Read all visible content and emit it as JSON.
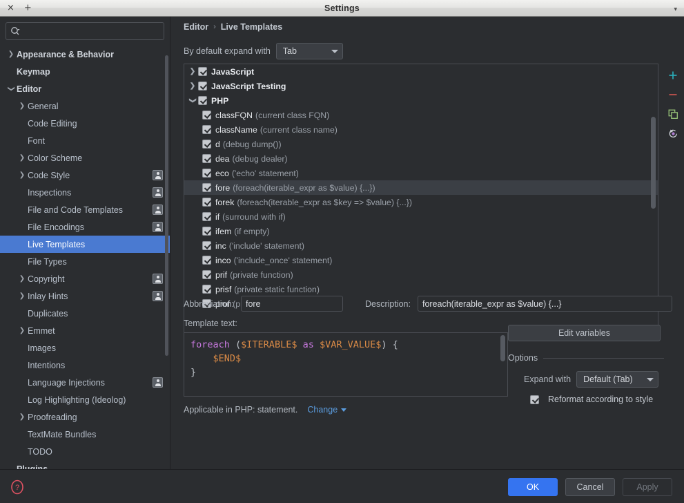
{
  "window": {
    "title": "Settings",
    "close_label": "×",
    "add_label": "+",
    "menu_caret": "▾"
  },
  "sidebar": {
    "search": {
      "value": "",
      "placeholder": ""
    },
    "items": [
      {
        "label": "Appearance & Behavior",
        "level": 0,
        "arrow": "collapsed",
        "bold": true,
        "badge": false,
        "selected": false
      },
      {
        "label": "Keymap",
        "level": 0,
        "arrow": "none",
        "bold": true,
        "badge": false,
        "selected": false
      },
      {
        "label": "Editor",
        "level": 0,
        "arrow": "expanded",
        "bold": true,
        "badge": false,
        "selected": false
      },
      {
        "label": "General",
        "level": 1,
        "arrow": "collapsed",
        "bold": false,
        "badge": false,
        "selected": false
      },
      {
        "label": "Code Editing",
        "level": 1,
        "arrow": "none",
        "bold": false,
        "badge": false,
        "selected": false
      },
      {
        "label": "Font",
        "level": 1,
        "arrow": "none",
        "bold": false,
        "badge": false,
        "selected": false
      },
      {
        "label": "Color Scheme",
        "level": 1,
        "arrow": "collapsed",
        "bold": false,
        "badge": false,
        "selected": false
      },
      {
        "label": "Code Style",
        "level": 1,
        "arrow": "collapsed",
        "bold": false,
        "badge": true,
        "selected": false
      },
      {
        "label": "Inspections",
        "level": 1,
        "arrow": "none",
        "bold": false,
        "badge": true,
        "selected": false
      },
      {
        "label": "File and Code Templates",
        "level": 1,
        "arrow": "none",
        "bold": false,
        "badge": true,
        "selected": false
      },
      {
        "label": "File Encodings",
        "level": 1,
        "arrow": "none",
        "bold": false,
        "badge": true,
        "selected": false
      },
      {
        "label": "Live Templates",
        "level": 1,
        "arrow": "none",
        "bold": false,
        "badge": false,
        "selected": true
      },
      {
        "label": "File Types",
        "level": 1,
        "arrow": "none",
        "bold": false,
        "badge": false,
        "selected": false
      },
      {
        "label": "Copyright",
        "level": 1,
        "arrow": "collapsed",
        "bold": false,
        "badge": true,
        "selected": false
      },
      {
        "label": "Inlay Hints",
        "level": 1,
        "arrow": "collapsed",
        "bold": false,
        "badge": true,
        "selected": false
      },
      {
        "label": "Duplicates",
        "level": 1,
        "arrow": "none",
        "bold": false,
        "badge": false,
        "selected": false
      },
      {
        "label": "Emmet",
        "level": 1,
        "arrow": "collapsed",
        "bold": false,
        "badge": false,
        "selected": false
      },
      {
        "label": "Images",
        "level": 1,
        "arrow": "none",
        "bold": false,
        "badge": false,
        "selected": false
      },
      {
        "label": "Intentions",
        "level": 1,
        "arrow": "none",
        "bold": false,
        "badge": false,
        "selected": false
      },
      {
        "label": "Language Injections",
        "level": 1,
        "arrow": "none",
        "bold": false,
        "badge": true,
        "selected": false
      },
      {
        "label": "Log Highlighting (Ideolog)",
        "level": 1,
        "arrow": "none",
        "bold": false,
        "badge": false,
        "selected": false
      },
      {
        "label": "Proofreading",
        "level": 1,
        "arrow": "collapsed",
        "bold": false,
        "badge": false,
        "selected": false
      },
      {
        "label": "TextMate Bundles",
        "level": 1,
        "arrow": "none",
        "bold": false,
        "badge": false,
        "selected": false
      },
      {
        "label": "TODO",
        "level": 1,
        "arrow": "none",
        "bold": false,
        "badge": false,
        "selected": false
      },
      {
        "label": "Plugins",
        "level": 0,
        "arrow": "none",
        "bold": true,
        "badge": false,
        "selected": false
      }
    ]
  },
  "breadcrumb": {
    "parent": "Editor",
    "separator": "›",
    "current": "Live Templates"
  },
  "expand_default": {
    "label": "By default expand with",
    "value": "Tab"
  },
  "templates": [
    {
      "kind": "group",
      "arrow": "collapsed",
      "abbr": "JavaScript",
      "desc": "",
      "checked": true,
      "selected": false
    },
    {
      "kind": "group",
      "arrow": "collapsed",
      "abbr": "JavaScript Testing",
      "desc": "",
      "checked": true,
      "selected": false
    },
    {
      "kind": "group",
      "arrow": "expanded",
      "abbr": "PHP",
      "desc": "",
      "checked": true,
      "selected": false
    },
    {
      "kind": "child",
      "abbr": "classFQN",
      "desc": "(current class FQN)",
      "checked": true,
      "selected": false
    },
    {
      "kind": "child",
      "abbr": "className",
      "desc": "(current class name)",
      "checked": true,
      "selected": false
    },
    {
      "kind": "child",
      "abbr": "d",
      "desc": "(debug dump())",
      "checked": true,
      "selected": false
    },
    {
      "kind": "child",
      "abbr": "dea",
      "desc": "(debug dealer)",
      "checked": true,
      "selected": false
    },
    {
      "kind": "child",
      "abbr": "eco",
      "desc": "('echo' statement)",
      "checked": true,
      "selected": false
    },
    {
      "kind": "child",
      "abbr": "fore",
      "desc": "(foreach(iterable_expr as $value) {...})",
      "checked": true,
      "selected": true
    },
    {
      "kind": "child",
      "abbr": "forek",
      "desc": "(foreach(iterable_expr as $key => $value) {...})",
      "checked": true,
      "selected": false
    },
    {
      "kind": "child",
      "abbr": "if",
      "desc": "(surround with if)",
      "checked": true,
      "selected": false
    },
    {
      "kind": "child",
      "abbr": "ifem",
      "desc": "(if empty)",
      "checked": true,
      "selected": false
    },
    {
      "kind": "child",
      "abbr": "inc",
      "desc": "('include' statement)",
      "checked": true,
      "selected": false
    },
    {
      "kind": "child",
      "abbr": "inco",
      "desc": "('include_once' statement)",
      "checked": true,
      "selected": false
    },
    {
      "kind": "child",
      "abbr": "prif",
      "desc": "(private function)",
      "checked": true,
      "selected": false
    },
    {
      "kind": "child",
      "abbr": "prisf",
      "desc": "(private static function)",
      "checked": true,
      "selected": false
    },
    {
      "kind": "child",
      "abbr": "prof",
      "desc": "(protected function)",
      "checked": true,
      "selected": false
    }
  ],
  "list_toolbar": [
    {
      "name": "add-icon",
      "glyph": "+",
      "color": "#2aacb8"
    },
    {
      "name": "remove-icon",
      "glyph": "−",
      "color": "#c75450"
    },
    {
      "name": "duplicate-icon",
      "glyph": "",
      "color": "#97c378"
    },
    {
      "name": "restore-icon",
      "glyph": "",
      "color": "#b07fd4"
    }
  ],
  "form": {
    "abbreviation_label": "Abbreviation:",
    "abbreviation_value": "fore",
    "description_label": "Description:",
    "description_value": "foreach(iterable_expr as $value) {...}",
    "template_text_label": "Template text:",
    "edit_variables_label": "Edit variables"
  },
  "template_text": {
    "line1_kw": "foreach",
    "line1_open": " (",
    "line1_var1": "$ITERABLE$",
    "line1_as": " as ",
    "line1_var2": "$VAR_VALUE$",
    "line1_close": ") {",
    "line2_var": "$END$",
    "line3": "}"
  },
  "options": {
    "title": "Options",
    "expand_with_label": "Expand with",
    "expand_with_value": "Default (Tab)",
    "reformat_label": "Reformat according to style",
    "reformat_checked": true
  },
  "applicable": {
    "text": "Applicable in PHP: statement.",
    "change_label": "Change"
  },
  "footer": {
    "help_label": "?",
    "ok_label": "OK",
    "cancel_label": "Cancel",
    "apply_label": "Apply"
  },
  "colors": {
    "accent_blue": "#3574f0",
    "selection_blue": "#4a7ad1",
    "background": "#2b2d30",
    "link_blue": "#5b9de0"
  }
}
